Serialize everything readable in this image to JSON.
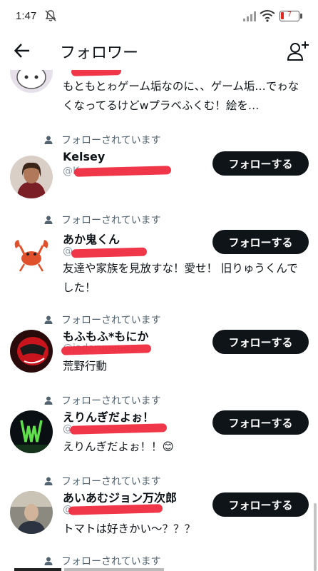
{
  "status": {
    "time": "1:47",
    "battery": "7"
  },
  "header": {
    "title": "フォロワー"
  },
  "follows_you_label": "フォローされています",
  "follow_button_label": "フォローする",
  "partial_item": {
    "bio": "もともとゎゲーム垢なのに、、ゲーム垢…でゎなくなってるけどwプラベふくむ！絵を…"
  },
  "users": [
    {
      "name": "Kelsey",
      "handle": "@K",
      "bio": ""
    },
    {
      "name": "あか鬼くん",
      "handle": "@",
      "bio": "友達や家族を見放すな！愛せ！ 旧りゅうくんでした！"
    },
    {
      "name": "もふもふ*もにか",
      "handle": "@jaderuuuuo",
      "bio": "荒野行動"
    },
    {
      "name": "えりんぎだよぉ！",
      "handle": "@",
      "bio": "えりんぎだよぉ！！😊"
    },
    {
      "name": "あいあむジョン万次郎",
      "handle": "@",
      "bio": "トマトは好きかい～？？？"
    }
  ],
  "last_item": {
    "follows_you": "フォローされています"
  },
  "colors": {
    "accent": "#0f1419",
    "secondary_text": "#536471",
    "battery_low": "#e0281f"
  }
}
